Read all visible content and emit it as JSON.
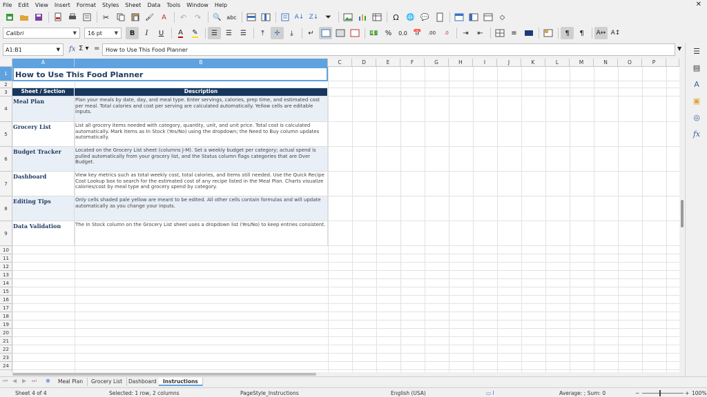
{
  "menu": [
    "File",
    "Edit",
    "View",
    "Insert",
    "Format",
    "Styles",
    "Sheet",
    "Data",
    "Tools",
    "Window",
    "Help"
  ],
  "font": {
    "name": "Calibri",
    "size": "16 pt"
  },
  "name_box": "A1:B1",
  "formula": "How to Use This Food Planner",
  "columns": [
    "A",
    "B",
    "C",
    "D",
    "E",
    "F",
    "G",
    "H",
    "I",
    "J",
    "K",
    "L",
    "M",
    "N",
    "O",
    "P"
  ],
  "rows": [
    "1",
    "2",
    "3",
    "4",
    "5",
    "6",
    "7",
    "8",
    "9",
    "10",
    "11",
    "12",
    "13",
    "14",
    "15",
    "16",
    "17",
    "18",
    "19",
    "20",
    "21",
    "22",
    "23",
    "24",
    "25"
  ],
  "sheet": {
    "title": "How to Use This Food Planner",
    "header": {
      "col_a": "Sheet / Section",
      "col_b": "Description"
    },
    "entries": [
      {
        "name": "Meal Plan",
        "desc": "Plan your meals by date, day, and meal type. Enter servings, calories, prep time, and estimated cost per meal. Total calories and cost per serving are calculated automatically. Yellow cells are editable inputs."
      },
      {
        "name": "Grocery List",
        "desc": "List all grocery items needed with category, quantity, unit, and unit price. Total cost is calculated automatically. Mark items as In Stock (Yes/No) using the dropdown; the Need to Buy column updates automatically."
      },
      {
        "name": "Budget Tracker",
        "desc": "Located on the Grocery List sheet (columns J-M). Set a weekly budget per category; actual spend is pulled automatically from your grocery list, and the Status column flags categories that are Over Budget."
      },
      {
        "name": "Dashboard",
        "desc": "View key metrics such as total weekly cost, total calories, and items still needed. Use the Quick Recipe Cost Lookup box to search for the estimated cost of any recipe listed in the Meal Plan. Charts visualize calories/cost by meal type and grocery spend by category."
      },
      {
        "name": "Editing Tips",
        "desc": "Only cells shaded pale yellow are meant to be edited. All other cells contain formulas and will update automatically as you change your inputs."
      },
      {
        "name": "Data Validation",
        "desc": "The In Stock column on the Grocery List sheet uses a dropdown list (Yes/No) to keep entries consistent."
      }
    ]
  },
  "tabs": [
    "Meal Plan",
    "Grocery List",
    "Dashboard",
    "Instructions"
  ],
  "status": {
    "sheet": "Sheet 4 of 4",
    "selection": "Selected: 1 row, 2 columns",
    "page_style": "PageStyle_Instructions",
    "language": "English (USA)",
    "summary": "Average: ; Sum: 0",
    "zoom": "100%"
  }
}
